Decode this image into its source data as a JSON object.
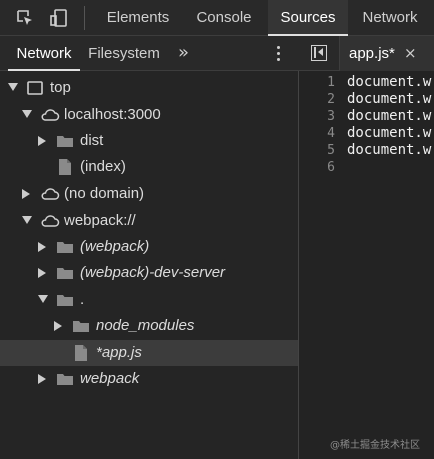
{
  "toolbar": {
    "inspect_icon": "inspect-element-icon",
    "device_icon": "device-toolbar-icon",
    "tabs": [
      {
        "label": "Elements",
        "active": false
      },
      {
        "label": "Console",
        "active": false
      },
      {
        "label": "Sources",
        "active": true
      },
      {
        "label": "Network",
        "active": false
      }
    ]
  },
  "sidebar": {
    "tabs": [
      {
        "label": "Network",
        "active": true
      },
      {
        "label": "Filesystem",
        "active": false
      }
    ],
    "more_label": "»",
    "tree": [
      {
        "label": "top",
        "icon": "frame-icon",
        "expanded": true,
        "italic": false
      },
      {
        "label": "localhost:3000",
        "icon": "cloud-icon",
        "expanded": true,
        "italic": false
      },
      {
        "label": "dist",
        "icon": "folder-icon",
        "expanded": false,
        "italic": false
      },
      {
        "label": "(index)",
        "icon": "file-icon",
        "expanded": null,
        "italic": false
      },
      {
        "label": "(no domain)",
        "icon": "cloud-icon",
        "expanded": false,
        "italic": false
      },
      {
        "label": "webpack://",
        "icon": "cloud-icon",
        "expanded": true,
        "italic": false
      },
      {
        "label": "(webpack)",
        "icon": "folder-icon",
        "expanded": false,
        "italic": true
      },
      {
        "label": "(webpack)-dev-server",
        "icon": "folder-icon",
        "expanded": false,
        "italic": true
      },
      {
        "label": ".",
        "icon": "folder-icon",
        "expanded": true,
        "italic": false
      },
      {
        "label": "node_modules",
        "icon": "folder-icon",
        "expanded": false,
        "italic": true
      },
      {
        "label": "*app.js",
        "icon": "file-icon",
        "expanded": null,
        "italic": true,
        "selected": true
      },
      {
        "label": "webpack",
        "icon": "folder-icon",
        "expanded": false,
        "italic": true
      }
    ]
  },
  "editor": {
    "file_tab": {
      "name": "app.js*",
      "close": "×"
    },
    "lines": [
      {
        "number": "1",
        "code": "document.w"
      },
      {
        "number": "2",
        "code": "document.w"
      },
      {
        "number": "3",
        "code": "document.w"
      },
      {
        "number": "4",
        "code": "document.w"
      },
      {
        "number": "5",
        "code": "document.w"
      },
      {
        "number": "6",
        "code": ""
      }
    ]
  },
  "watermark": "@稀土掘金技术社区",
  "colors": {
    "background": "#242424",
    "toolbar": "#292929",
    "selected_row": "#3c3c3c",
    "text": "#dcdcdc"
  }
}
